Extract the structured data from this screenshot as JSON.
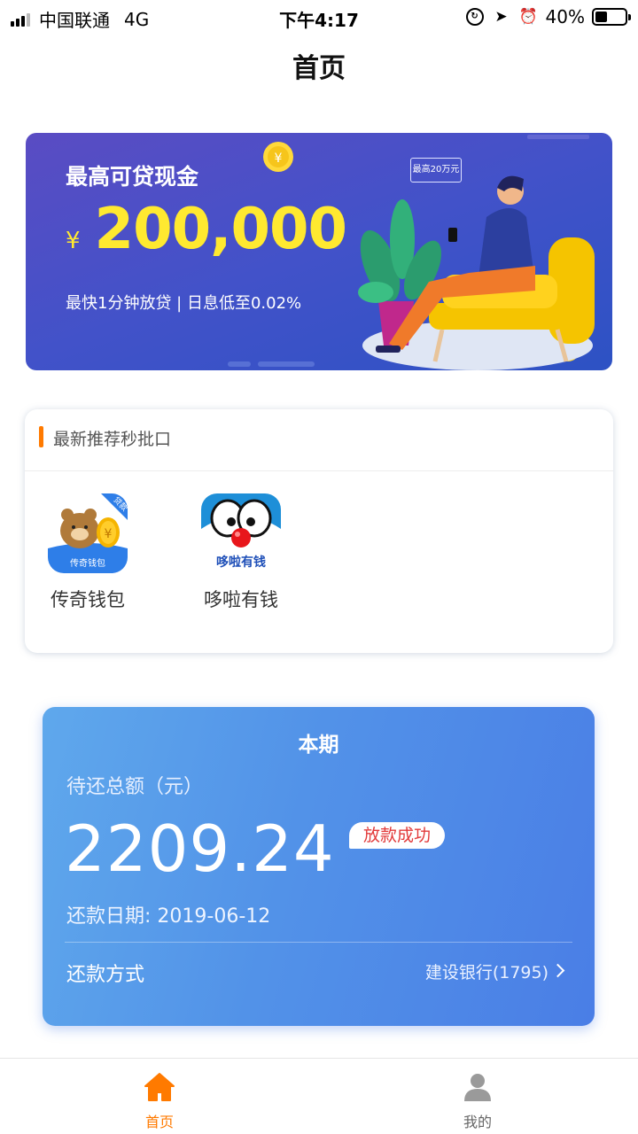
{
  "status_bar": {
    "carrier": "中国联通",
    "network": "4G",
    "time": "下午4:17",
    "battery": "40%",
    "battery_level": 0.4
  },
  "nav": {
    "title": "首页"
  },
  "banner": {
    "title": "最高可贷现金",
    "currency": "¥",
    "amount": "200,000",
    "subtitle": "最快1分钟放贷 | 日息低至0.02%",
    "bubble_text": "最高20万元",
    "colors": {
      "amount": "#ffe930",
      "bg_start": "#5a4cc3",
      "bg_end": "#2d52c4"
    }
  },
  "recommend": {
    "title": "最新推荐秒批口",
    "accent_color": "#ff7a00",
    "apps": [
      {
        "name": "传奇钱包",
        "icon": "bear-coin-icon",
        "icon_caption": "传奇钱包",
        "icon_ribbon": "贷款"
      },
      {
        "name": "哆啦有钱",
        "icon": "doraemon-face-icon",
        "icon_caption": "哆啦有钱"
      }
    ]
  },
  "repayment": {
    "period": "本期",
    "total_label": "待还总额（元）",
    "amount": "2209.24",
    "status_badge": "放款成功",
    "due_date": "还款日期: 2019-06-12",
    "method_label": "还款方式",
    "method_value": "建设银行(1795)",
    "colors": {
      "badge_text": "#e23a3a",
      "card_start": "#5fa8ec",
      "card_end": "#4a7ee6"
    }
  },
  "tab_bar": {
    "tabs": [
      {
        "label": "首页",
        "icon": "home-icon",
        "active": true
      },
      {
        "label": "我的",
        "icon": "user-icon",
        "active": false
      }
    ],
    "active_color": "#ff7a00",
    "inactive_color": "#666666"
  }
}
